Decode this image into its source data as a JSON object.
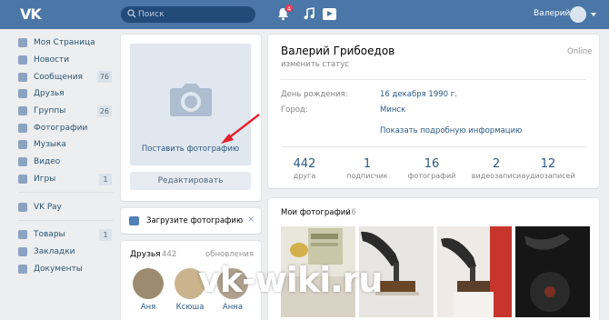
{
  "topbar": {
    "logo": "VK",
    "search_placeholder": "Поиск",
    "notifications_count": "4",
    "username": "Валерий"
  },
  "sidebar": {
    "items": [
      {
        "label": "Моя Страница",
        "count": ""
      },
      {
        "label": "Новости",
        "count": ""
      },
      {
        "label": "Сообщения",
        "count": "76"
      },
      {
        "label": "Друзья",
        "count": ""
      },
      {
        "label": "Группы",
        "count": "26"
      },
      {
        "label": "Фотографии",
        "count": ""
      },
      {
        "label": "Музыка",
        "count": ""
      },
      {
        "label": "Видео",
        "count": ""
      },
      {
        "label": "Игры",
        "count": "1"
      }
    ],
    "items2": [
      {
        "label": "VK Pay",
        "count": ""
      }
    ],
    "items3": [
      {
        "label": "Товары",
        "count": "1"
      },
      {
        "label": "Закладки",
        "count": ""
      },
      {
        "label": "Документы",
        "count": ""
      }
    ]
  },
  "photo_block": {
    "set_photo": "Поставить фотографию",
    "edit": "Редактировать"
  },
  "upload": {
    "label": "Загрузите фотографию",
    "close": "×"
  },
  "friends": {
    "title": "Друзья",
    "count": "442",
    "updates": "обновления",
    "names": [
      "Аня",
      "Ксюша",
      "Анна"
    ]
  },
  "profile": {
    "name": "Валерий Грибоедов",
    "status": "изменить статус",
    "online": "Online",
    "birthday_label": "День рождения:",
    "birthday_value": "16 декабря 1990 г.",
    "city_label": "Город:",
    "city_value": "Минск",
    "more": "Показать подробную информацию",
    "stats": [
      {
        "num": "442",
        "label": "друга"
      },
      {
        "num": "1",
        "label": "подписчик"
      },
      {
        "num": "16",
        "label": "фотографий"
      },
      {
        "num": "2",
        "label": "видеозаписи"
      },
      {
        "num": "12",
        "label": "аудиозаписей"
      }
    ]
  },
  "photos": {
    "title": "Мои фотографии",
    "count": "16"
  },
  "watermark": "vk-wiki.ru",
  "colors": {
    "header": "#4a76a8",
    "link": "#2a5885",
    "background": "#edeef0",
    "arrow": "#e6202b"
  }
}
